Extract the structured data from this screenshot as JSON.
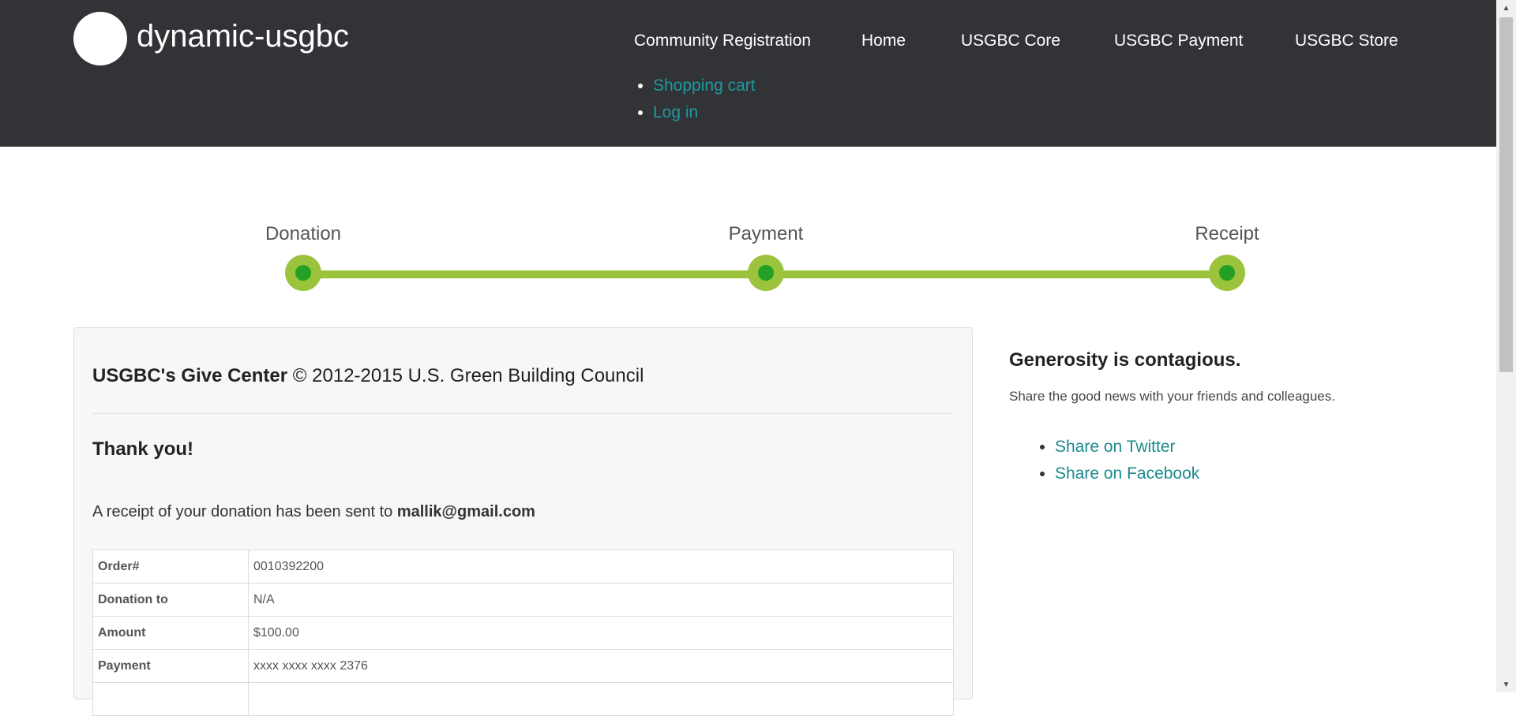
{
  "site": {
    "name": "dynamic-usgbc"
  },
  "nav": {
    "items": [
      {
        "label": "Community Registration"
      },
      {
        "label": "Home"
      },
      {
        "label": "USGBC Core"
      },
      {
        "label": "USGBC Payment"
      },
      {
        "label": "USGBC Store"
      }
    ]
  },
  "user_menu": {
    "items": [
      {
        "label": "Shopping cart"
      },
      {
        "label": "Log in"
      }
    ]
  },
  "steps": [
    {
      "label": "Donation"
    },
    {
      "label": "Payment"
    },
    {
      "label": "Receipt"
    }
  ],
  "receipt": {
    "title_bold": "USGBC's Give Center",
    "title_rest": " © 2012-2015 U.S. Green Building Council",
    "thanks": "Thank you!",
    "sent_prefix": "A receipt of your donation has been sent to ",
    "email": "mallik@gmail.com",
    "rows": [
      {
        "label": "Order#",
        "value": "0010392200"
      },
      {
        "label": "Donation to",
        "value": "N/A"
      },
      {
        "label": "Amount",
        "value": "$100.00"
      },
      {
        "label": "Payment",
        "value": "xxxx xxxx xxxx 2376"
      },
      {
        "label": "",
        "value": ""
      }
    ]
  },
  "sidebar": {
    "title": "Generosity is contagious.",
    "text": "Share the good news with your friends and colleagues.",
    "links": [
      {
        "label": "Share on Twitter"
      },
      {
        "label": "Share on Facebook"
      }
    ]
  },
  "colors": {
    "header_bg": "#323337",
    "link": "#1c9a9e",
    "progress": "#9bc33c",
    "progress_dot": "#24a124"
  }
}
